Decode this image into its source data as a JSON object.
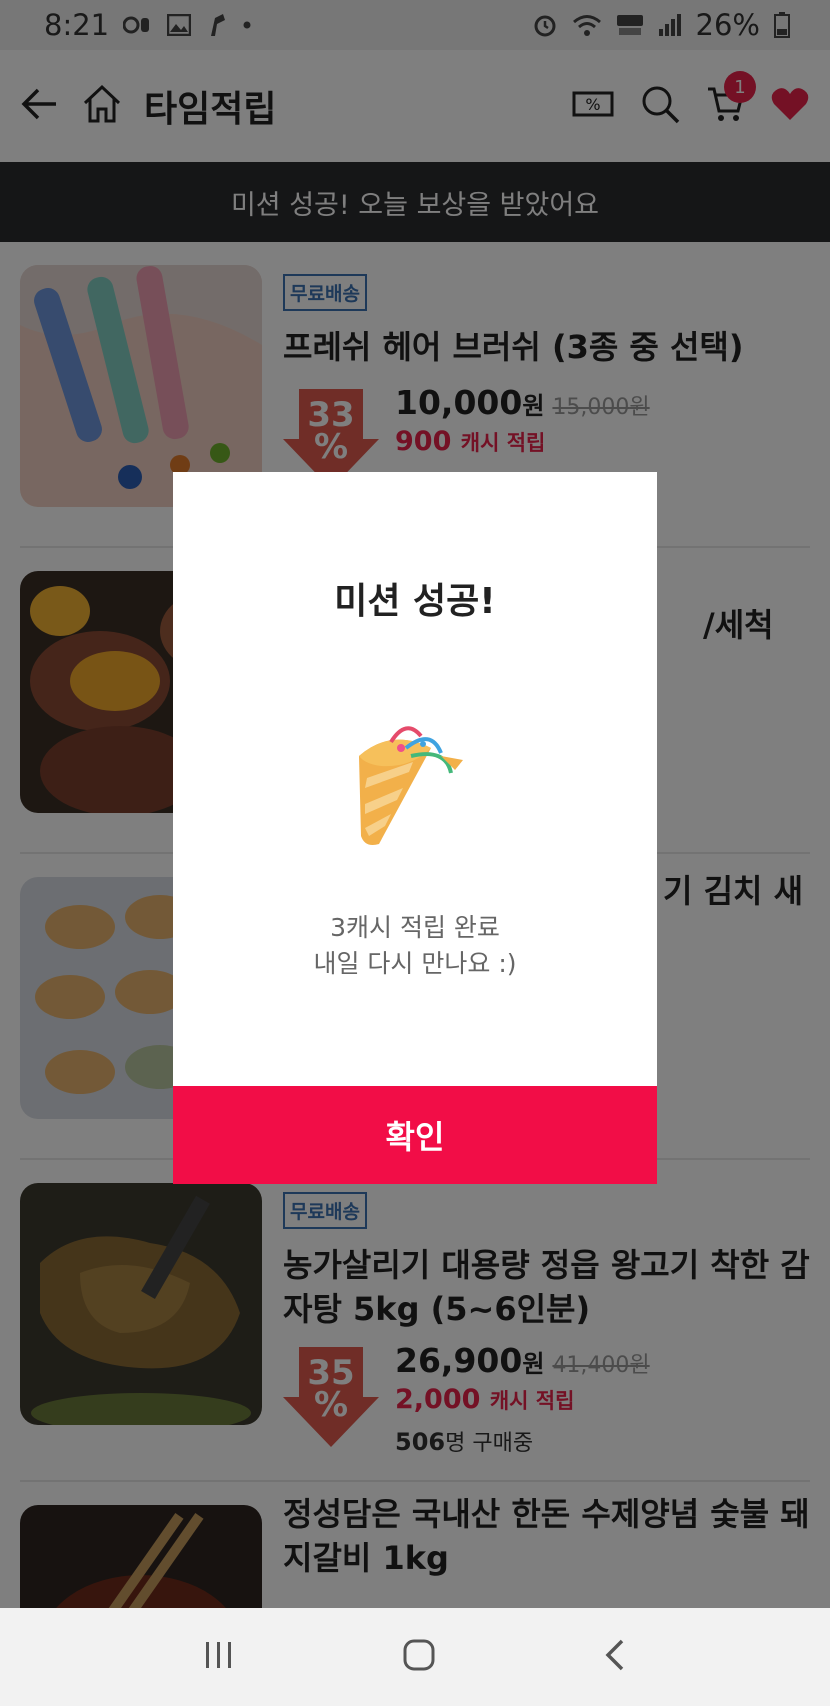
{
  "status_bar": {
    "time": "8:21",
    "battery": "26%"
  },
  "header": {
    "title": "타임적립",
    "cart_count": "1"
  },
  "banner": {
    "text": "미션 성공! 오늘 보상을 받았어요"
  },
  "products": [
    {
      "tag": "무료배송",
      "name": "프레쉬 헤어 브러쉬 (3종 중 선택)",
      "discount": "33",
      "discount_unit": "%",
      "price": "10,000",
      "price_unit": "원",
      "original_price": "15,000",
      "original_unit": "원",
      "cash": "900",
      "cash_label": "캐시 적립"
    },
    {
      "name": "/세척"
    },
    {
      "name": "기 김치 새"
    },
    {
      "tag": "무료배송",
      "name": "농가살리기 대용량 정읍 왕고기 착한 감자탕 5kg (5~6인분)",
      "discount": "35",
      "discount_unit": "%",
      "price": "26,900",
      "price_unit": "원",
      "original_price": "41,400",
      "original_unit": "원",
      "cash": "2,000",
      "cash_label": "캐시 적립",
      "buyers": "506",
      "buyers_label": "명 구매중"
    },
    {
      "name": "정성담은 국내산 한돈 수제양념 숯불 돼지갈비 1kg"
    }
  ],
  "modal": {
    "title": "미션 성공!",
    "icon": "party-popper-icon",
    "message_line1": "3캐시 적립 완료",
    "message_line2": "내일 다시 만나요 :)",
    "confirm_label": "확인"
  },
  "colors": {
    "accent": "#f20d47",
    "banner_bg": "#2b2c2f",
    "tag_blue": "#3c72b3",
    "discount_red": "#e05a4f"
  }
}
